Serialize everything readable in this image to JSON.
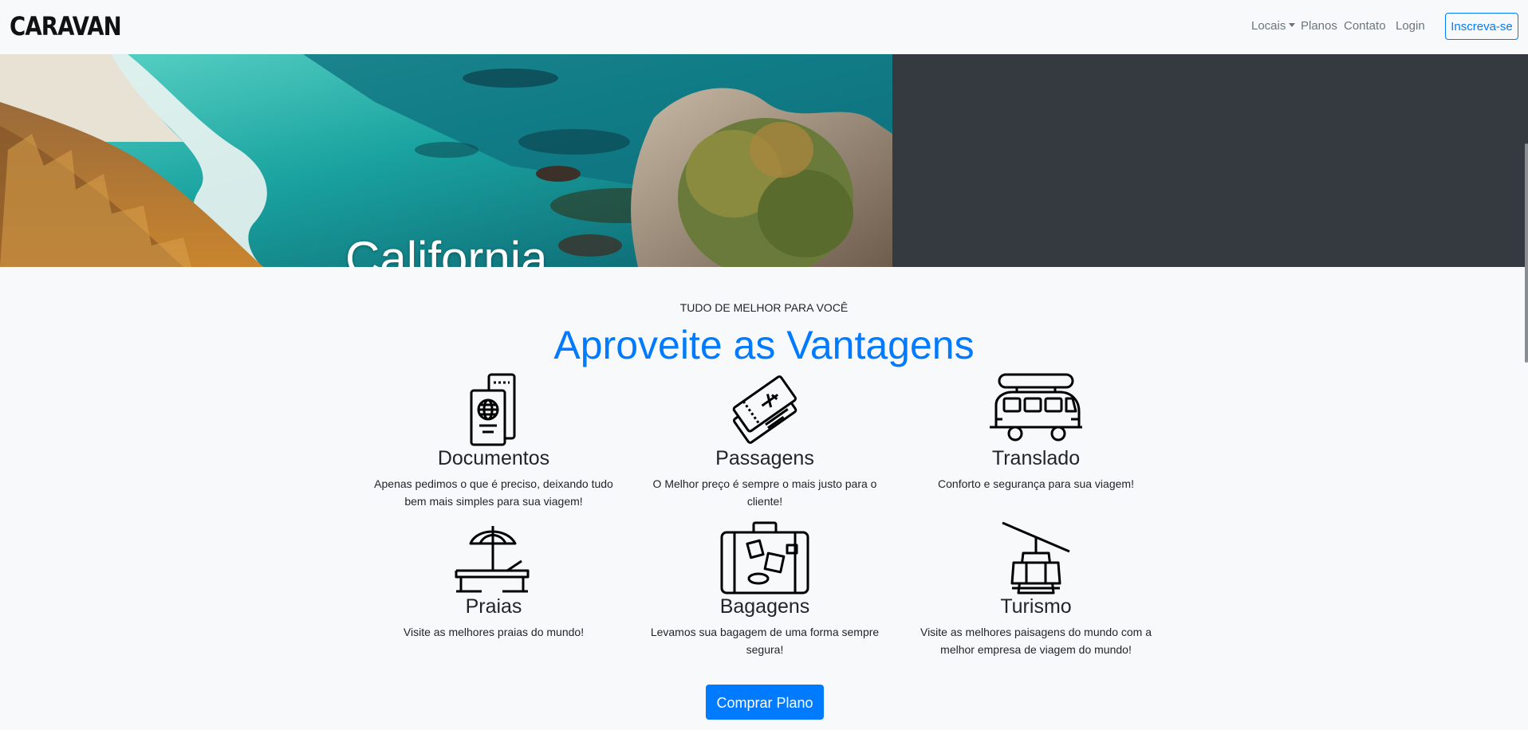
{
  "brand": "CARAVAN",
  "nav": {
    "locais": "Locais",
    "planos": "Planos",
    "contato": "Contato",
    "login": "Login",
    "signup": "Inscreva-se"
  },
  "hero": {
    "caption": "California",
    "slide_count": 4,
    "active_slide": 1
  },
  "section": {
    "eyebrow": "TUDO DE MELHOR PARA VOCÊ",
    "title": "Aproveite as Vantagens"
  },
  "features": [
    {
      "icon": "passport-icon",
      "title": "Documentos",
      "desc_line1": "Apenas pedimos o que é preciso, deixando tudo",
      "desc_line2": "bem mais simples para sua viagem!"
    },
    {
      "icon": "plane-ticket-icon",
      "title": "Passagens",
      "desc_line1": "O Melhor preço é sempre o mais justo para o",
      "desc_line2": "cliente!"
    },
    {
      "icon": "van-icon",
      "title": "Translado",
      "desc_line1": "Conforto e segurança para sua viagem!",
      "desc_line2": ""
    },
    {
      "icon": "beach-icon",
      "title": "Praias",
      "desc_line1": "Visite as melhores praias do mundo!",
      "desc_line2": ""
    },
    {
      "icon": "suitcase-icon",
      "title": "Bagagens",
      "desc_line1": "Levamos sua bagagem de uma forma sempre",
      "desc_line2": "segura!"
    },
    {
      "icon": "cable-car-icon",
      "title": "Turismo",
      "desc_line1": "Visite as melhores paisagens do mundo com a",
      "desc_line2": "melhor empresa de viagem do mundo!"
    }
  ],
  "cta": "Comprar Plano",
  "colors": {
    "accent": "#007bff",
    "hero_right": "#343a40",
    "background": "#f8f9fa"
  }
}
